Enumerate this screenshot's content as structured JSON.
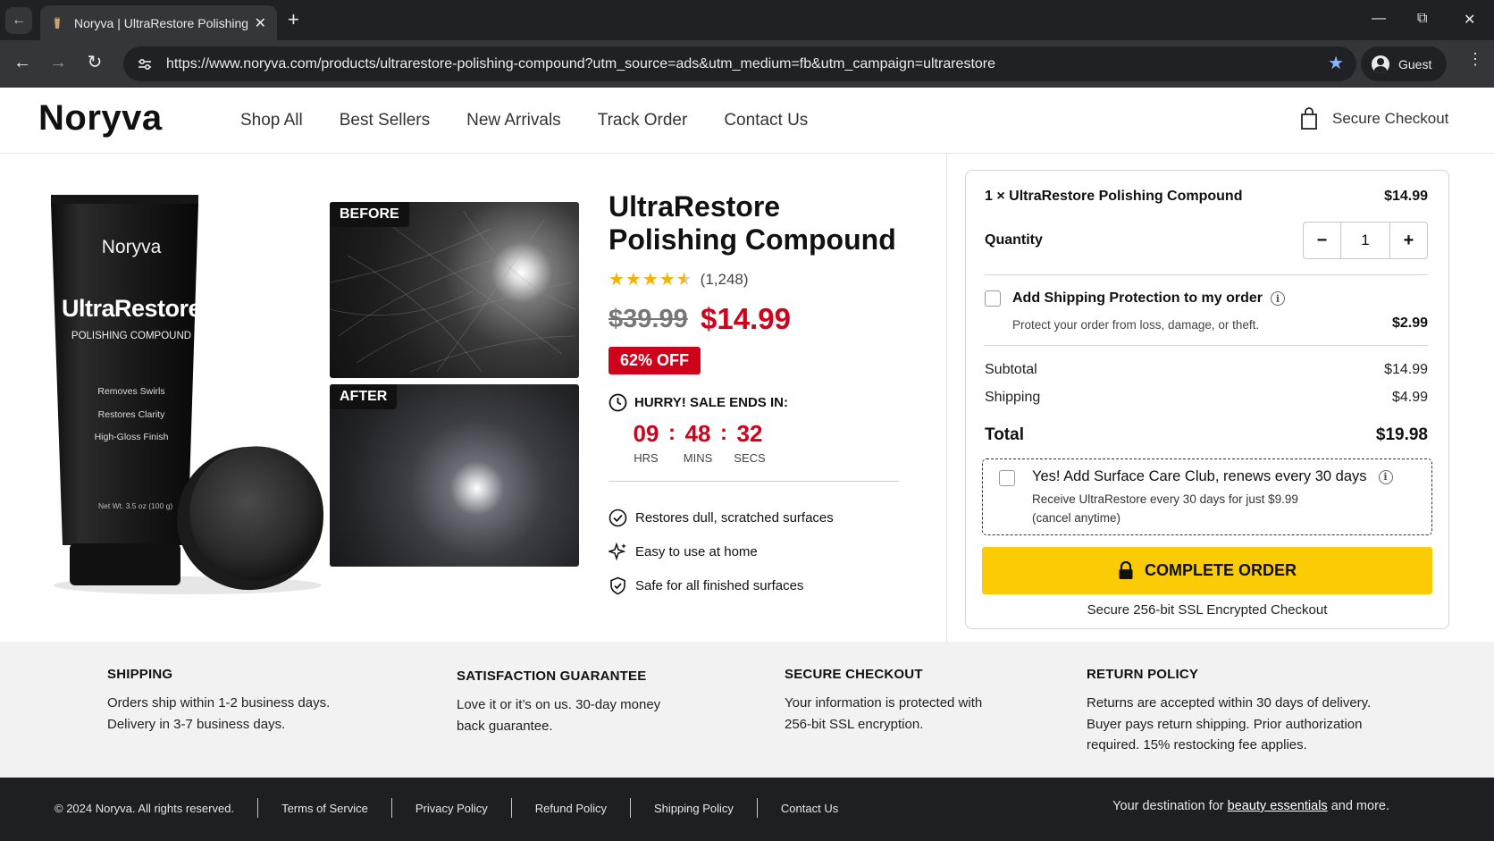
{
  "browser": {
    "tab_title": "Noryva | UltraRestore Polishing",
    "url": "https://www.noryva.com/products/ultrarestore-polishing-compound?utm_source=ads&utm_medium=fb&utm_campaign=ultrarestore",
    "profile_label": "Guest"
  },
  "header": {
    "logo": "Noryva",
    "nav": [
      "Shop All",
      "Best Sellers",
      "New Arrivals",
      "Track Order",
      "Contact Us"
    ],
    "checkout_label": "Secure Checkout"
  },
  "product_image": {
    "brand": "Noryva",
    "name": "UltraRestore",
    "subtitle": "POLISHING COMPOUND",
    "benefits": [
      "Removes Swirls",
      "Restores Clarity",
      "High-Gloss Finish"
    ],
    "net_wt": "Net Wt. 3.5 oz (100 g)"
  },
  "comparison": {
    "before_label": "BEFORE",
    "after_label": "AFTER"
  },
  "product": {
    "title": "UltraRestore Polishing Compound",
    "rating_value": 4.5,
    "rating_count": "(1,248)",
    "old_price": "$39.99",
    "price": "$14.99",
    "discount": "62% OFF",
    "sale_label": "HURRY! SALE ENDS IN:",
    "countdown": {
      "hrs": "09",
      "mins": "48",
      "secs": "32",
      "hrs_label": "HRS",
      "mins_label": "MINS",
      "secs_label": "SECS",
      "sep": ":"
    },
    "features": [
      "Restores dull, scratched surfaces",
      "Easy to use at home",
      "Safe for all finished surfaces"
    ]
  },
  "order": {
    "item_label": "1 × UltraRestore Polishing Compound",
    "item_price": "$14.99",
    "quantity_label": "Quantity",
    "quantity": "1",
    "minus": "−",
    "plus": "+",
    "protection_label": "Add Shipping Protection to my order",
    "protection_desc": "Protect your order from loss, damage, or theft.",
    "protection_price": "$2.99",
    "subtotal_label": "Subtotal",
    "subtotal": "$14.99",
    "shipping_label": "Shipping",
    "shipping": "$4.99",
    "total_label": "Total",
    "total": "$19.98",
    "club_label": "Yes! Add Surface Care Club, renews every 30 days",
    "club_desc_1": "Receive UltraRestore every 30 days for just $9.99",
    "club_desc_2": "(cancel anytime)",
    "complete_label": "COMPLETE ORDER",
    "secure_note": "Secure 256-bit SSL Encrypted Checkout"
  },
  "info": [
    {
      "title": "SHIPPING",
      "lines": [
        "Orders ship within 1-2 business days.",
        "Delivery in 3-7 business days."
      ]
    },
    {
      "title": "SATISFACTION GUARANTEE",
      "lines": [
        "Love it or it’s on us. 30-day money",
        "back guarantee."
      ]
    },
    {
      "title": "SECURE CHECKOUT",
      "lines": [
        "Your information is protected with",
        "256-bit SSL encryption."
      ]
    },
    {
      "title": "RETURN POLICY",
      "lines": [
        "Returns are accepted within 30 days of delivery.",
        "Buyer pays return shipping. Prior authorization",
        "required. 15% restocking fee applies."
      ]
    }
  ],
  "footer": {
    "copyright": "© 2024 Noryva. All rights reserved.",
    "links": [
      "Terms of Service",
      "Privacy Policy",
      "Refund Policy",
      "Shipping Policy",
      "Contact Us"
    ],
    "tagline_pre": "Your destination for",
    "tagline_link": "beauty essentials",
    "tagline_post": "and more."
  },
  "colors": {
    "accent_red": "#d0021b",
    "cta_yellow": "#fbcc05",
    "star": "#f5b301",
    "dark": "#1d1f22"
  }
}
